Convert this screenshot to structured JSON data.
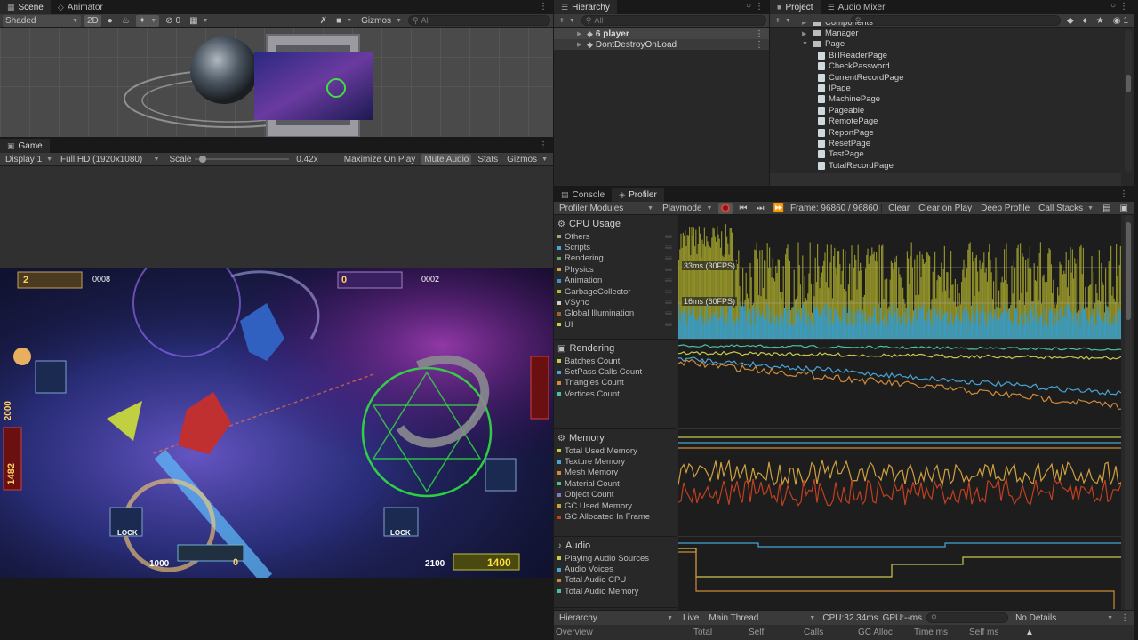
{
  "scene": {
    "tabs": [
      {
        "label": "Scene",
        "icon": "grid-icon"
      },
      {
        "label": "Animator",
        "icon": "animator-icon"
      }
    ],
    "shading": "Shaded",
    "mode_2d": "2D",
    "gizmos": "Gizmos",
    "search_placeholder": "All",
    "hidden_count": "0"
  },
  "game": {
    "tab": "Game",
    "display": "Display 1",
    "resolution": "Full HD (1920x1080)",
    "scale_label": "Scale",
    "scale_value": "0.42x",
    "scale_fraction": 0.42,
    "maximize": "Maximize On Play",
    "mute": "Mute Audio",
    "stats": "Stats",
    "gizmos": "Gizmos",
    "hud": {
      "p1_credit": "2",
      "p1_bet": "0008",
      "p2_credit": "0",
      "p2_bet": "0002",
      "p3_credit": "2100",
      "p3_bet": "0",
      "p4_credit": "1400",
      "p4_bet": "1000",
      "left_a": "2000",
      "left_b": "1482",
      "lock": "LOCK"
    }
  },
  "hierarchy": {
    "tab": "Hierarchy",
    "search_placeholder": "All",
    "items": [
      {
        "label": "6 player",
        "selected": true
      },
      {
        "label": "DontDestroyOnLoad",
        "selected": false
      }
    ]
  },
  "project": {
    "tabs": [
      {
        "label": "Project"
      },
      {
        "label": "Audio Mixer"
      }
    ],
    "tree": [
      {
        "label": "Components",
        "type": "folder",
        "depth": 1
      },
      {
        "label": "Manager",
        "type": "folder",
        "depth": 1
      },
      {
        "label": "Page",
        "type": "folder",
        "depth": 1,
        "expanded": true
      },
      {
        "label": "BillReaderPage",
        "type": "file",
        "depth": 2
      },
      {
        "label": "CheckPassword",
        "type": "file",
        "depth": 2
      },
      {
        "label": "CurrentRecordPage",
        "type": "file",
        "depth": 2
      },
      {
        "label": "IPage",
        "type": "file",
        "depth": 2
      },
      {
        "label": "MachinePage",
        "type": "file",
        "depth": 2
      },
      {
        "label": "Pageable",
        "type": "file",
        "depth": 2
      },
      {
        "label": "RemotePage",
        "type": "file",
        "depth": 2
      },
      {
        "label": "ReportPage",
        "type": "file",
        "depth": 2
      },
      {
        "label": "ResetPage",
        "type": "file",
        "depth": 2
      },
      {
        "label": "TestPage",
        "type": "file",
        "depth": 2
      },
      {
        "label": "TotalRecordPage",
        "type": "file",
        "depth": 2
      }
    ],
    "count": "1"
  },
  "profiler": {
    "tabs": [
      {
        "label": "Console"
      },
      {
        "label": "Profiler"
      }
    ],
    "modules_dropdown": "Profiler Modules",
    "playmode": "Playmode",
    "frame": "Frame: 96860 / 96860",
    "clear": "Clear",
    "clear_on_play": "Clear on Play",
    "deep_profile": "Deep Profile",
    "call_stacks": "Call Stacks",
    "modules": [
      {
        "title": "CPU Usage",
        "icon": "cpu-icon",
        "items": [
          {
            "label": "Others",
            "color": "#a5a57a"
          },
          {
            "label": "Scripts",
            "color": "#4aa4d4"
          },
          {
            "label": "Rendering",
            "color": "#6ea36e"
          },
          {
            "label": "Physics",
            "color": "#d4a24a"
          },
          {
            "label": "Animation",
            "color": "#4a8cd4"
          },
          {
            "label": "GarbageCollector",
            "color": "#b8b83c"
          },
          {
            "label": "VSync",
            "color": "#d0d0d0"
          },
          {
            "label": "Global Illumination",
            "color": "#a06030"
          },
          {
            "label": "UI",
            "color": "#d0d040"
          }
        ]
      },
      {
        "title": "Rendering",
        "icon": "rendering-icon",
        "items": [
          {
            "label": "Batches Count",
            "color": "#c8c850"
          },
          {
            "label": "SetPass Calls Count",
            "color": "#4aa4d4"
          },
          {
            "label": "Triangles Count",
            "color": "#d08a3a"
          },
          {
            "label": "Vertices Count",
            "color": "#4ac0a0"
          }
        ]
      },
      {
        "title": "Memory",
        "icon": "memory-icon",
        "items": [
          {
            "label": "Total Used Memory",
            "color": "#c8c850"
          },
          {
            "label": "Texture Memory",
            "color": "#4aa4d4"
          },
          {
            "label": "Mesh Memory",
            "color": "#d08a3a"
          },
          {
            "label": "Material Count",
            "color": "#4ac0a0"
          },
          {
            "label": "Object Count",
            "color": "#7a7ad0"
          },
          {
            "label": "GC Used Memory",
            "color": "#d0a040"
          },
          {
            "label": "GC Allocated In Frame",
            "color": "#c04020"
          }
        ]
      },
      {
        "title": "Audio",
        "icon": "audio-icon",
        "items": [
          {
            "label": "Playing Audio Sources",
            "color": "#c8c850"
          },
          {
            "label": "Audio Voices",
            "color": "#4aa4d4"
          },
          {
            "label": "Total Audio CPU",
            "color": "#d08a3a"
          },
          {
            "label": "Total Audio Memory",
            "color": "#4ac0a0"
          }
        ]
      }
    ],
    "fps_30": "33ms (30FPS)",
    "fps_60": "16ms (60FPS)",
    "bottom": {
      "view": "Hierarchy",
      "live": "Live",
      "thread": "Main Thread",
      "cpu": "CPU:32.34ms",
      "gpu": "GPU:--ms",
      "details": "No Details"
    },
    "columns": [
      "Overview",
      "Total",
      "Self",
      "Calls",
      "GC Alloc",
      "Time ms",
      "Self ms"
    ]
  }
}
